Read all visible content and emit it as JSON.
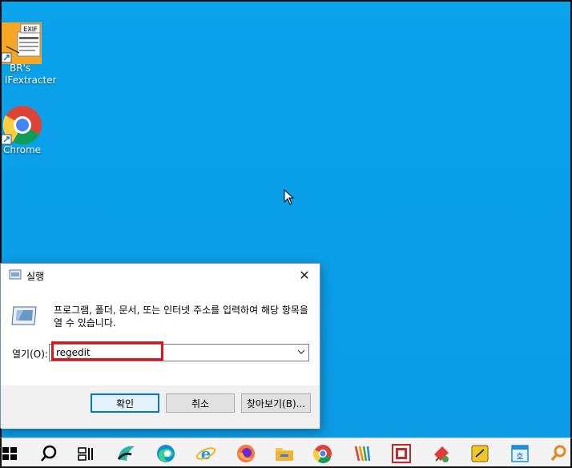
{
  "desktop": {
    "icons": [
      {
        "label_line1": "BR's",
        "label_line2": "lFextracter",
        "badge": "EXIF"
      },
      {
        "label_line1": "Chrome"
      }
    ]
  },
  "run_dialog": {
    "title": "실행",
    "description": "프로그램, 폴더, 문서, 또는 인터넷 주소를 입력하여 해당 항목을 열 수 있습니다.",
    "open_label": "열기(O):",
    "open_value": "regedit",
    "buttons": {
      "ok": "확인",
      "cancel": "취소",
      "browse": "찾아보기(B)..."
    },
    "close_glyph": "✕"
  },
  "taskbar": {
    "items": [
      "start-icon",
      "search-icon",
      "task-view-icon",
      "app-icon",
      "edge-icon",
      "ie-icon",
      "firefox-icon",
      "file-explorer-icon",
      "chrome-icon",
      "app-icon",
      "app-icon",
      "app-icon",
      "app-icon",
      "app-icon",
      "search-magnifier-icon"
    ],
    "hangul_label": "호"
  },
  "colors": {
    "desktop": "#0aa3ec",
    "highlight": "#d9161c",
    "accent": "#0078d7"
  }
}
